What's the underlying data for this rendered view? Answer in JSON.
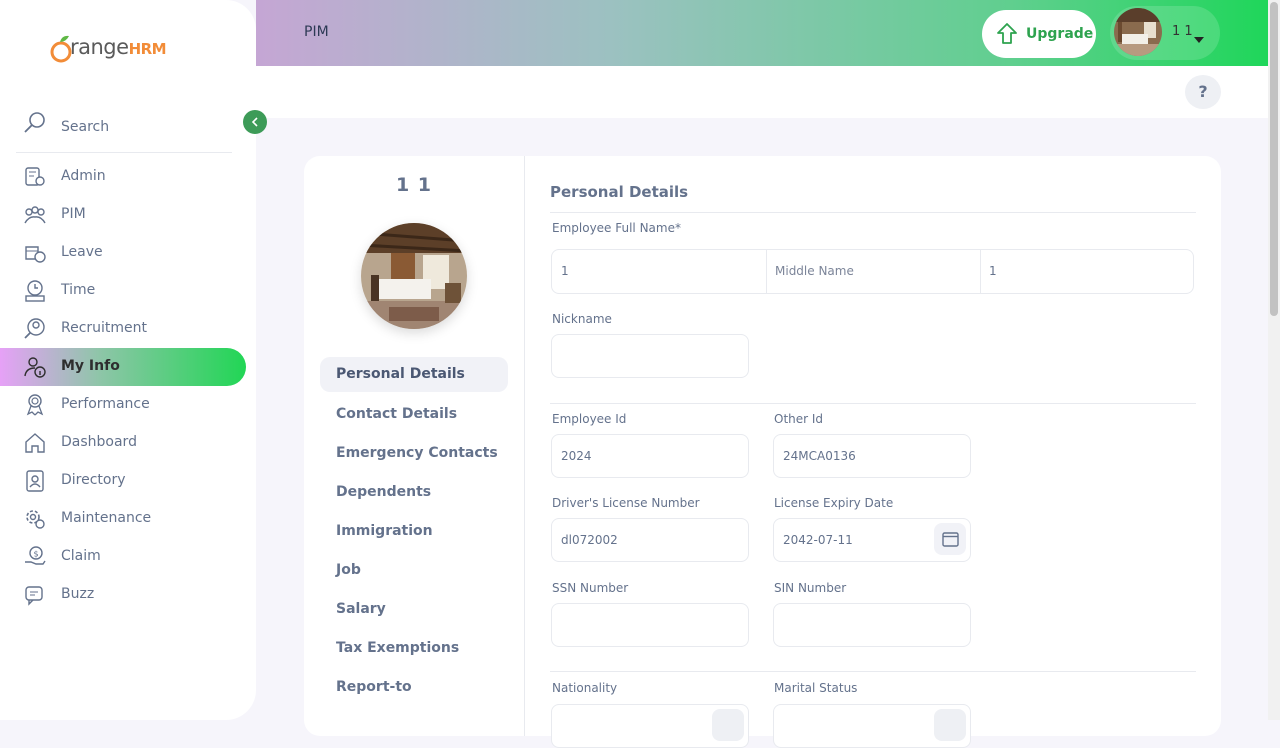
{
  "brand": {
    "name_main": "range",
    "name_o": "O",
    "name_hrm": "HRM"
  },
  "sidebar": {
    "search_label": "Search",
    "items": [
      {
        "label": "Admin",
        "icon": "admin-icon"
      },
      {
        "label": "PIM",
        "icon": "pim-icon"
      },
      {
        "label": "Leave",
        "icon": "leave-icon"
      },
      {
        "label": "Time",
        "icon": "time-icon"
      },
      {
        "label": "Recruitment",
        "icon": "recruitment-icon"
      },
      {
        "label": "My Info",
        "icon": "my-info-icon"
      },
      {
        "label": "Performance",
        "icon": "performance-icon"
      },
      {
        "label": "Dashboard",
        "icon": "dashboard-icon"
      },
      {
        "label": "Directory",
        "icon": "directory-icon"
      },
      {
        "label": "Maintenance",
        "icon": "maintenance-icon"
      },
      {
        "label": "Claim",
        "icon": "claim-icon"
      },
      {
        "label": "Buzz",
        "icon": "buzz-icon"
      }
    ],
    "active": "My Info"
  },
  "topbar": {
    "title": "PIM",
    "upgrade_label": "Upgrade",
    "user_name": "1 1",
    "help_label": "?"
  },
  "profile": {
    "name": "1 1",
    "tabs": [
      "Personal Details",
      "Contact Details",
      "Emergency Contacts",
      "Dependents",
      "Immigration",
      "Job",
      "Salary",
      "Tax Exemptions",
      "Report-to"
    ]
  },
  "form": {
    "section_title": "Personal Details",
    "full_name_label": "Employee Full Name*",
    "first_name": "1",
    "middle_name_placeholder": "Middle Name",
    "last_name": "1",
    "nickname_label": "Nickname",
    "nickname": "",
    "employee_id_label": "Employee Id",
    "employee_id": "2024",
    "other_id_label": "Other Id",
    "other_id": "24MCA0136",
    "license_label": "Driver's License Number",
    "license": "dl072002",
    "license_expiry_label": "License Expiry Date",
    "license_expiry": "2042-07-11",
    "ssn_label": "SSN Number",
    "ssn": "",
    "sin_label": "SIN Number",
    "sin": "",
    "nationality_label": "Nationality",
    "marital_label": "Marital Status"
  },
  "colors": {
    "accent": "#21d655",
    "brand_green": "#3d9b58",
    "text": "#64728c"
  }
}
